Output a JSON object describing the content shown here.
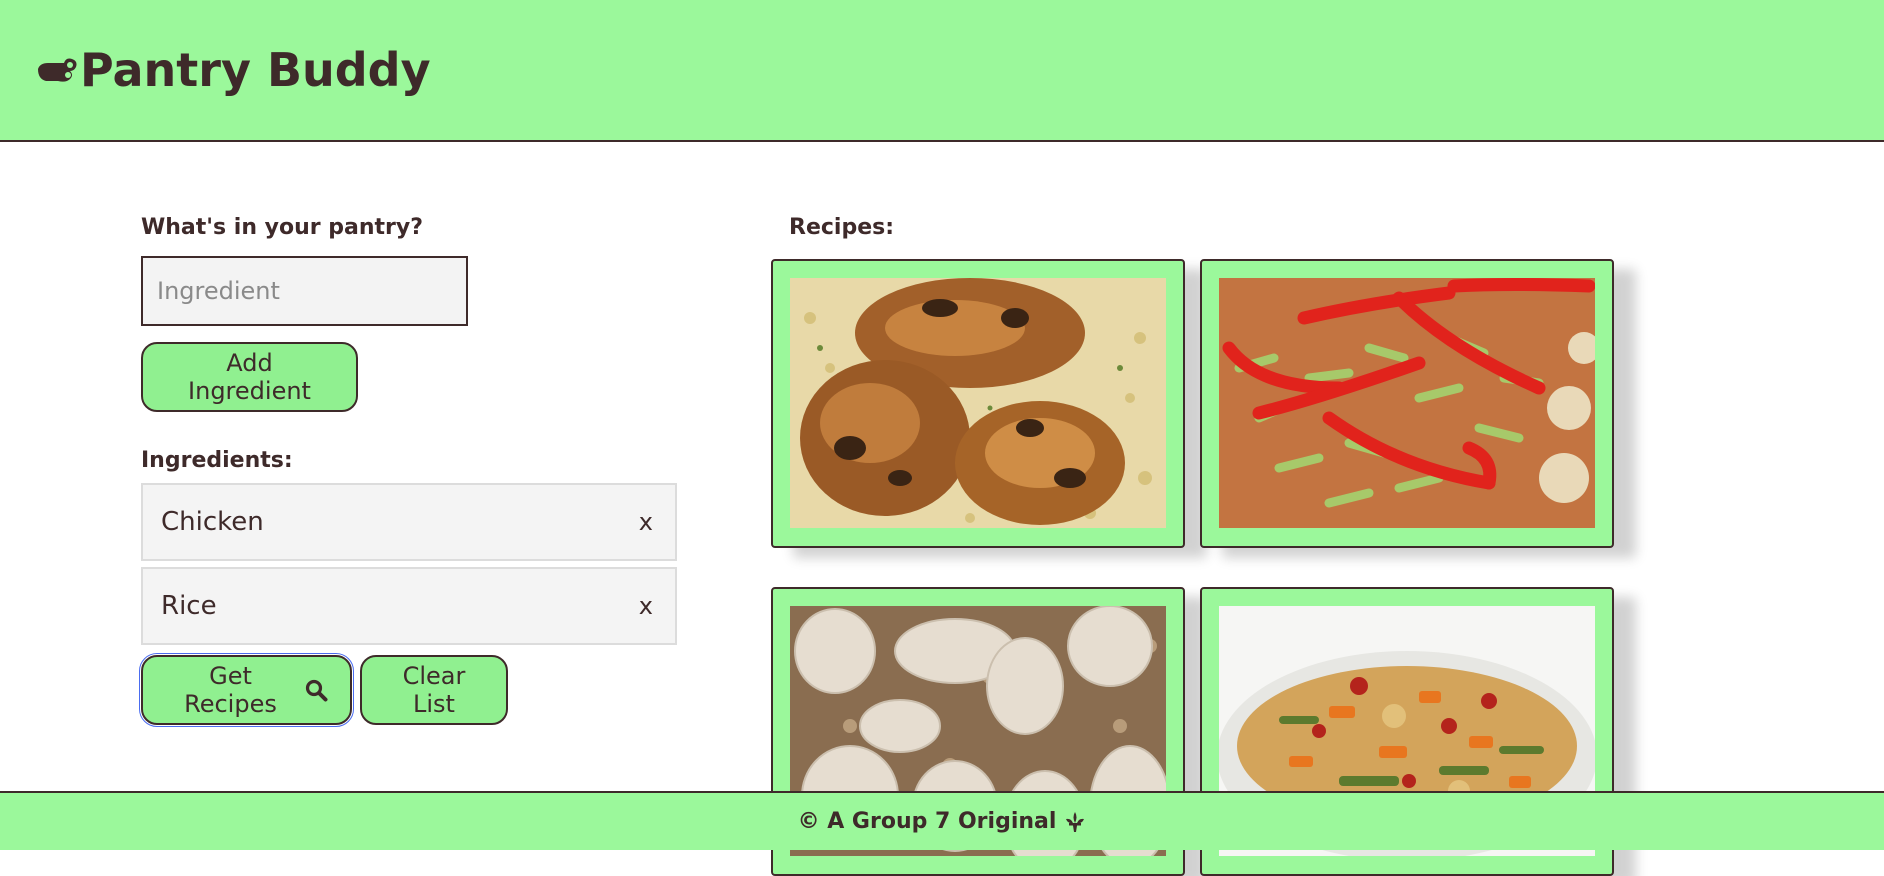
{
  "header": {
    "title": "Pantry Buddy",
    "logo_icon": "gravy-boat-icon"
  },
  "pantry": {
    "label": "What's in your pantry?",
    "input_placeholder": "Ingredient",
    "input_value": "",
    "add_label": "Add Ingredient"
  },
  "ingredients": {
    "label": "Ingredients:",
    "items": [
      {
        "name": "Chicken",
        "remove": "x"
      },
      {
        "name": "Rice",
        "remove": "x"
      }
    ]
  },
  "actions": {
    "get_recipes_label": "Get Recipes",
    "get_recipes_icon": "search-icon",
    "clear_label": "Clear List"
  },
  "recipes": {
    "label": "Recipes:",
    "cards": [
      {
        "image": "roast-chicken-on-rice-photo"
      },
      {
        "image": "stir-fry-with-red-peppers-photo"
      },
      {
        "image": "chicken-breasts-on-rice-photo"
      },
      {
        "image": "vegetable-rice-bowl-photo"
      }
    ]
  },
  "footer": {
    "text": "© A Group 7 Original",
    "icon": "fleur-de-lis-icon"
  },
  "colors": {
    "accent": "#9bf89b",
    "button": "#90f090",
    "text": "#3e2a2a"
  }
}
